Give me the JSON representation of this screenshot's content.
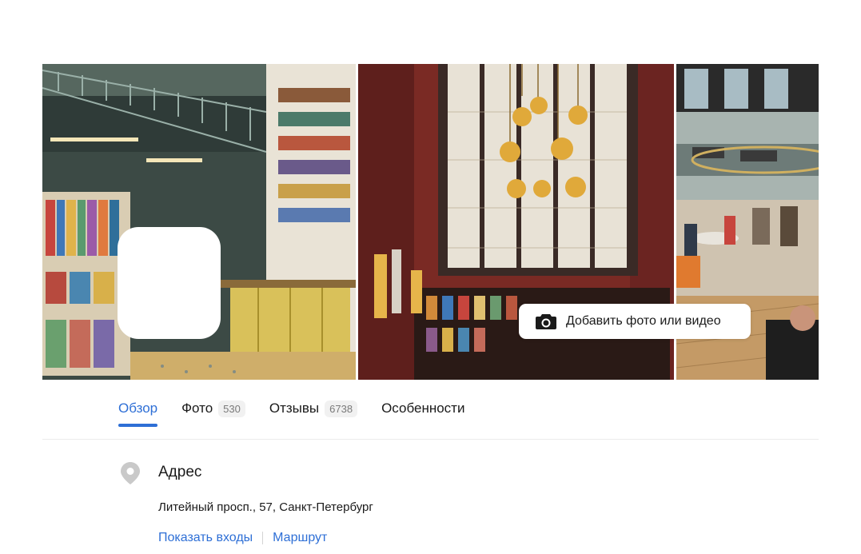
{
  "gallery": {
    "photos": [
      {
        "icon": "bookstore-interior-photo"
      },
      {
        "icon": "stained-window-chandelier-photo"
      },
      {
        "icon": "cafe-seating-photo"
      }
    ],
    "add_media_label": "Добавить фото или видео",
    "add_media_icon": "camera-icon"
  },
  "tabs": [
    {
      "label": "Обзор",
      "active": true
    },
    {
      "label": "Фото",
      "count": "530"
    },
    {
      "label": "Отзывы",
      "count": "6738"
    },
    {
      "label": "Особенности"
    }
  ],
  "address": {
    "title": "Адрес",
    "text": "Литейный просп., 57, Санкт-Петербург",
    "icon": "location-pin-icon",
    "links": {
      "entrances": "Показать входы",
      "route": "Маршрут"
    }
  },
  "colors": {
    "accent": "#2e6fd6"
  }
}
